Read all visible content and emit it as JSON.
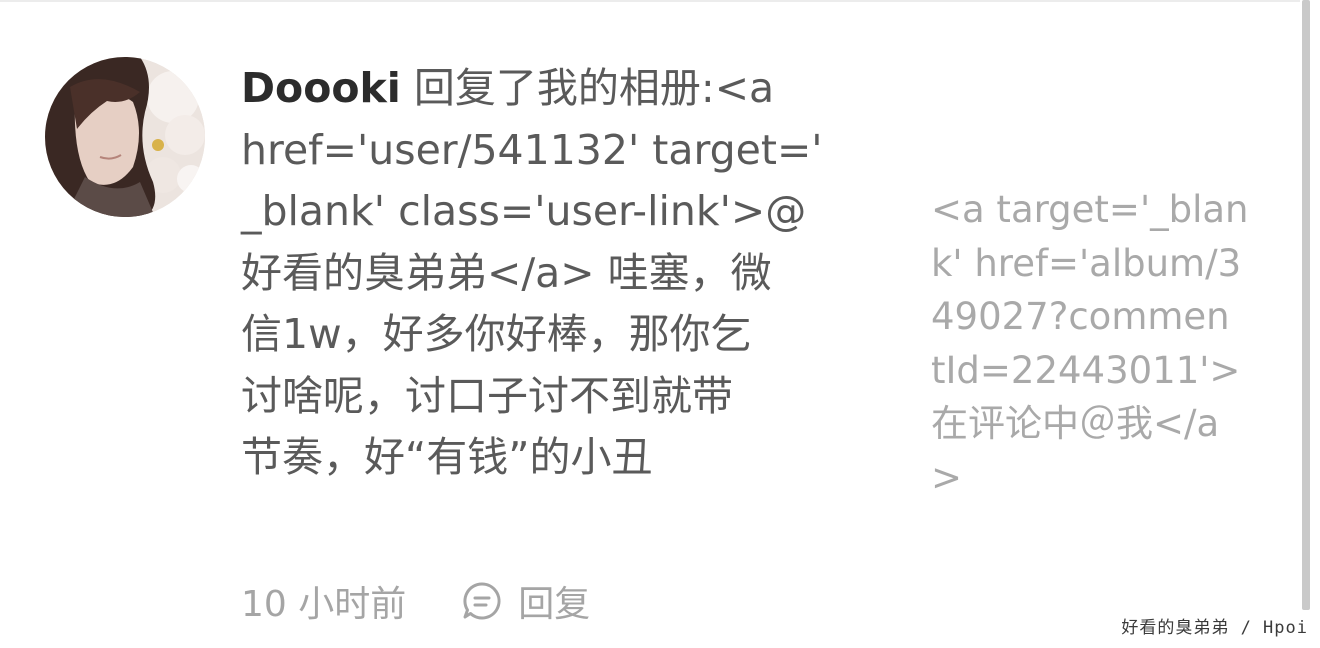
{
  "notification": {
    "author": "Doooki",
    "message_lines": [
      " 回复了我的相册:<a",
      "href='user/541132' target='",
      "_blank' class='user-link'>@",
      "好看的臭弟弟</a> 哇塞，微",
      "信1w，好多你好棒，那你乞",
      "讨啥呢，讨口子讨不到就带",
      "节奏，好“有钱”的小丑"
    ],
    "album_ref_lines": [
      "<a target='_blan",
      "k' href='album/3",
      "49027?commen",
      "tId=22443011'>",
      "在评论中＠我</a",
      ">"
    ],
    "timestamp": "10 小时前",
    "reply_label": "回复"
  },
  "icons": {
    "avatar": "user-avatar-illustration",
    "reply": "comment-bubble-icon"
  },
  "watermark": "好看的臭弟弟 / Hpoi",
  "colors": {
    "author": "#2c2c2c",
    "message": "#5a5a5a",
    "album_ref": "#a9a9a9",
    "meta": "#a5a5a5"
  }
}
